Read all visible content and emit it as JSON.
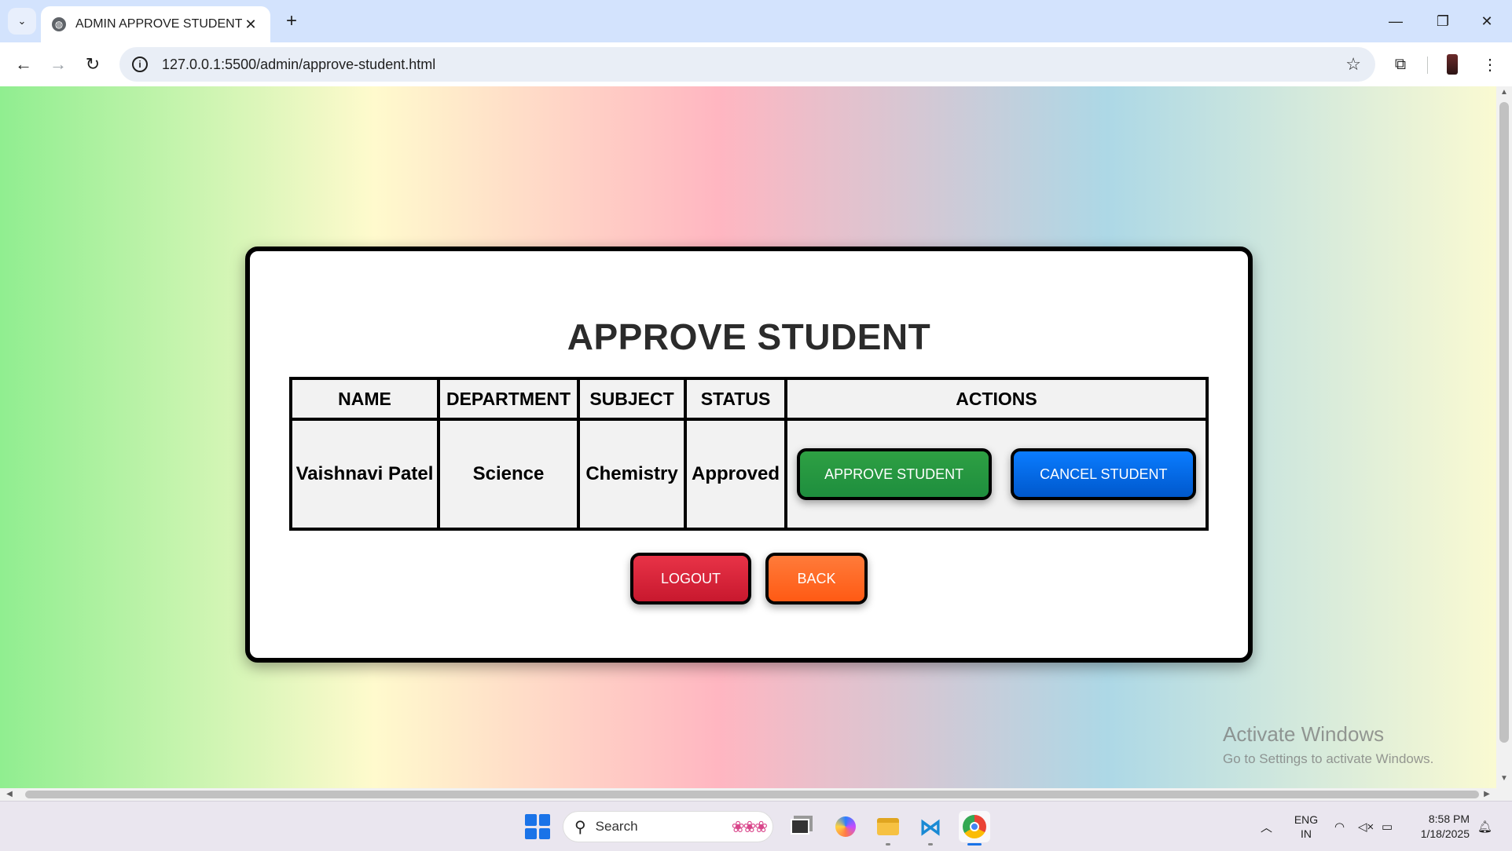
{
  "browser": {
    "tab_title": "ADMIN APPROVE STUDENT",
    "url": "127.0.0.1:5500/admin/approve-student.html"
  },
  "page": {
    "title": "APPROVE STUDENT",
    "table": {
      "headers": [
        "NAME",
        "DEPARTMENT",
        "SUBJECT",
        "STATUS",
        "ACTIONS"
      ],
      "rows": [
        {
          "name": "Vaishnavi Patel",
          "department": "Science",
          "subject": "Chemistry",
          "status": "Approved"
        }
      ]
    },
    "buttons": {
      "approve": "APPROVE STUDENT",
      "cancel": "CANCEL STUDENT",
      "logout": "LOGOUT",
      "back": "BACK"
    },
    "colors": {
      "approve": "#1e8e3e",
      "cancel": "#0058cc",
      "logout": "#c8182e",
      "back": "#ff5a14"
    }
  },
  "watermark": {
    "title": "Activate Windows",
    "subtitle": "Go to Settings to activate Windows."
  },
  "taskbar": {
    "search_placeholder": "Search",
    "language": [
      "ENG",
      "IN"
    ],
    "time": "8:58 PM",
    "date": "1/18/2025"
  }
}
